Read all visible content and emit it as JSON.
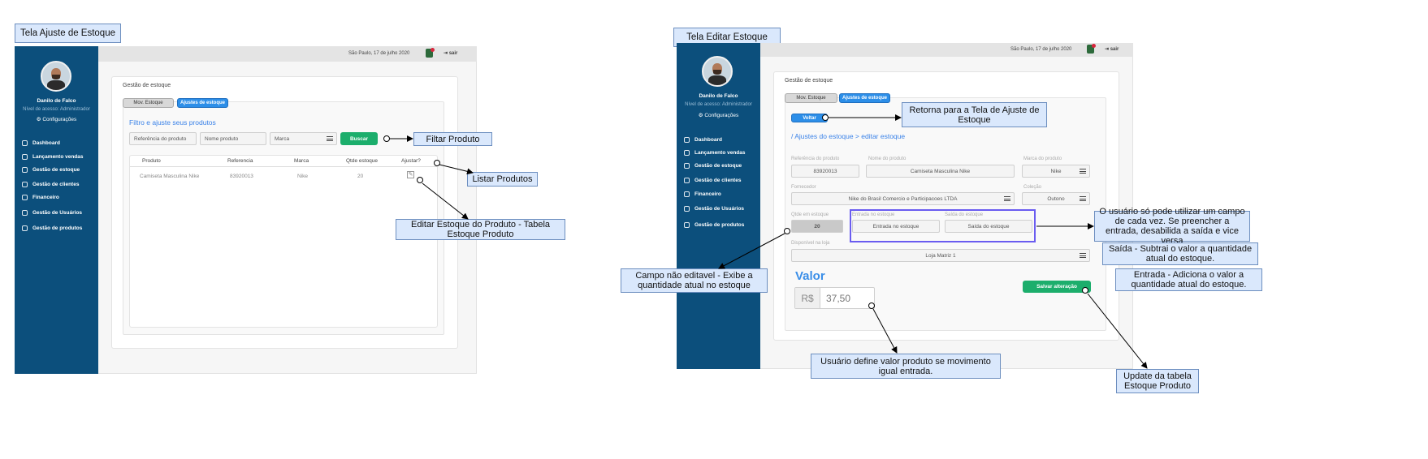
{
  "screen1": {
    "title": "Tela Ajuste de Estoque",
    "topbar": {
      "date": "São Paulo, 17 de julho 2020",
      "logout": "sair"
    },
    "user": {
      "name": "Danilo de Falco",
      "level": "Nível de acesso: Administrador",
      "settings": "Configurações"
    },
    "nav": [
      "Dashboard",
      "Lançamento vendas",
      "Gestão de estoque",
      "Gestão de clientes",
      "Financeiro",
      "Gestão de Usuários",
      "Gestão de produtos"
    ],
    "page_title": "Gestão de estoque",
    "tabs": [
      "Mov. Estoque",
      "Ajustes de estoque"
    ],
    "filter_title": "Filtro e ajuste seus produtos",
    "filters": {
      "ref_placeholder": "Referência do produto",
      "name_placeholder": "Nome produto",
      "brand_placeholder": "Marca",
      "search_button": "Buscar"
    },
    "table": {
      "headers": [
        "Produto",
        "Referencia",
        "Marca",
        "Qtde estoque",
        "Ajustar?"
      ],
      "rows": [
        {
          "produto": "Camiseta Masculina Nike",
          "referencia": "83920013",
          "marca": "Nike",
          "qtde": "20"
        }
      ]
    },
    "callouts": {
      "filter": "Filtar Produto",
      "list": "Listar Produtos",
      "edit": "Editar Estoque do Produto - Tabela Estoque Produto"
    }
  },
  "screen2": {
    "title": "Tela Editar Estoque",
    "topbar": {
      "date": "São Paulo, 17 de julho 2020",
      "logout": "sair"
    },
    "user": {
      "name": "Danilo de Falco",
      "level": "Nível de acesso: Administrador",
      "settings": "Configurações"
    },
    "nav": [
      "Dashboard",
      "Lançamento vendas",
      "Gestão de estoque",
      "Gestão de clientes",
      "Financeiro",
      "Gestão de Usuários",
      "Gestão de produtos"
    ],
    "page_title": "Gestão de estoque",
    "tabs": [
      "Mov. Estoque",
      "Ajustes de estoque"
    ],
    "back_button": "Voltar",
    "breadcrumb": "/ Ajustes do estoque > editar estoque",
    "form": {
      "ref_label": "Referência do produto",
      "ref_value": "83920013",
      "name_label": "Nome do produto",
      "name_value": "Camiseta Masculina Nike",
      "brand_label": "Marca do produto",
      "brand_value": "Nike",
      "supplier_label": "Fornecedor",
      "supplier_value": "Nike do Brasil Comercio e Participacoes LTDA",
      "collection_label": "Coleção",
      "collection_value": "Outono",
      "qty_label": "Qtde em estoque",
      "qty_value": "20",
      "in_label": "Entrada no estoque",
      "in_placeholder": "Entrada no estoque",
      "out_label": "Saída do estoque",
      "out_placeholder": "Saída do estoque",
      "store_label": "Disponível na loja",
      "store_value": "Loja Matriz 1",
      "value_title": "Valor",
      "currency": "R$",
      "price": "37,50",
      "save_button": "Salvar alteração"
    },
    "callouts": {
      "back": "Retorna para a Tela de Ajuste de Estoque",
      "one_field": "O usuário só pode utilizar um campo de cada vez. Se preencher a entrada, desabilida a saída e vice versa",
      "exit": "Saída - Subtrai o valor a quantidade atual do estoque.",
      "entry": "Entrada - Adiciona o valor a quantidade atual do estoque.",
      "readonly": "Campo não editavel - Exibe a quantidade atual no estoque",
      "price": "Usuário define valor produto se movimento igual entrada.",
      "update": "Update da tabela Estoque Produto"
    }
  },
  "colors": {
    "sidebar": "#0c4f7c",
    "accent_blue": "#2c8ee8",
    "green": "#1cae6c",
    "callout_fill": "#dae8fc",
    "callout_border": "#6c8ebf",
    "highlight": "#6a5cf0"
  }
}
